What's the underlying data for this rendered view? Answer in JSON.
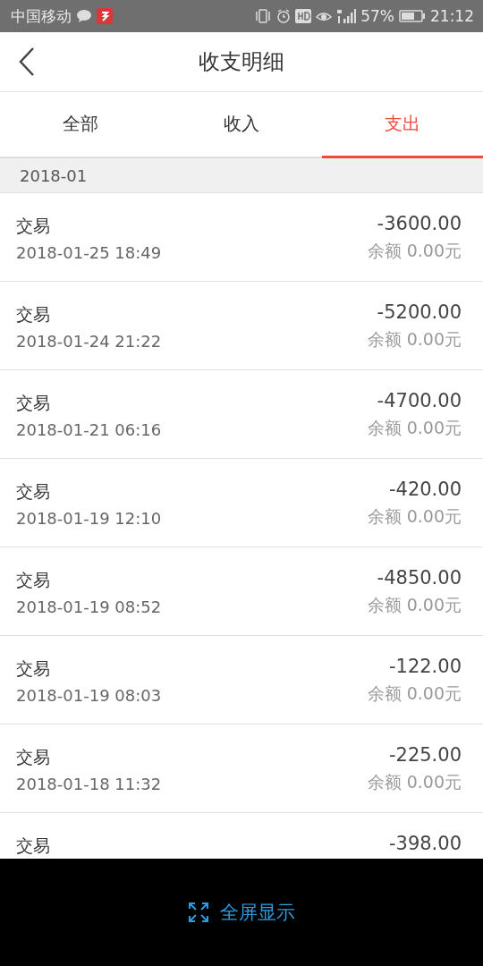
{
  "status_bar": {
    "carrier": "中国移动",
    "battery": "57%",
    "time": "21:12"
  },
  "header": {
    "title": "收支明细"
  },
  "tabs": [
    {
      "label": "全部",
      "selected": false
    },
    {
      "label": "收入",
      "selected": false
    },
    {
      "label": "支出",
      "selected": true
    }
  ],
  "section": {
    "title": "2018-01"
  },
  "rows": [
    {
      "title": "交易",
      "date": "2018-01-25 18:49",
      "amount": "-3600.00",
      "balance": "余额 0.00元"
    },
    {
      "title": "交易",
      "date": "2018-01-24 21:22",
      "amount": "-5200.00",
      "balance": "余额 0.00元"
    },
    {
      "title": "交易",
      "date": "2018-01-21 06:16",
      "amount": "-4700.00",
      "balance": "余额 0.00元"
    },
    {
      "title": "交易",
      "date": "2018-01-19 12:10",
      "amount": "-420.00",
      "balance": "余额 0.00元"
    },
    {
      "title": "交易",
      "date": "2018-01-19 08:52",
      "amount": "-4850.00",
      "balance": "余额 0.00元"
    },
    {
      "title": "交易",
      "date": "2018-01-19 08:03",
      "amount": "-122.00",
      "balance": "余额 0.00元"
    },
    {
      "title": "交易",
      "date": "2018-01-18 11:32",
      "amount": "-225.00",
      "balance": "余额 0.00元"
    },
    {
      "title": "交易",
      "amount": "-398.00"
    }
  ],
  "bottom_bar": {
    "label": "全屏显示"
  }
}
